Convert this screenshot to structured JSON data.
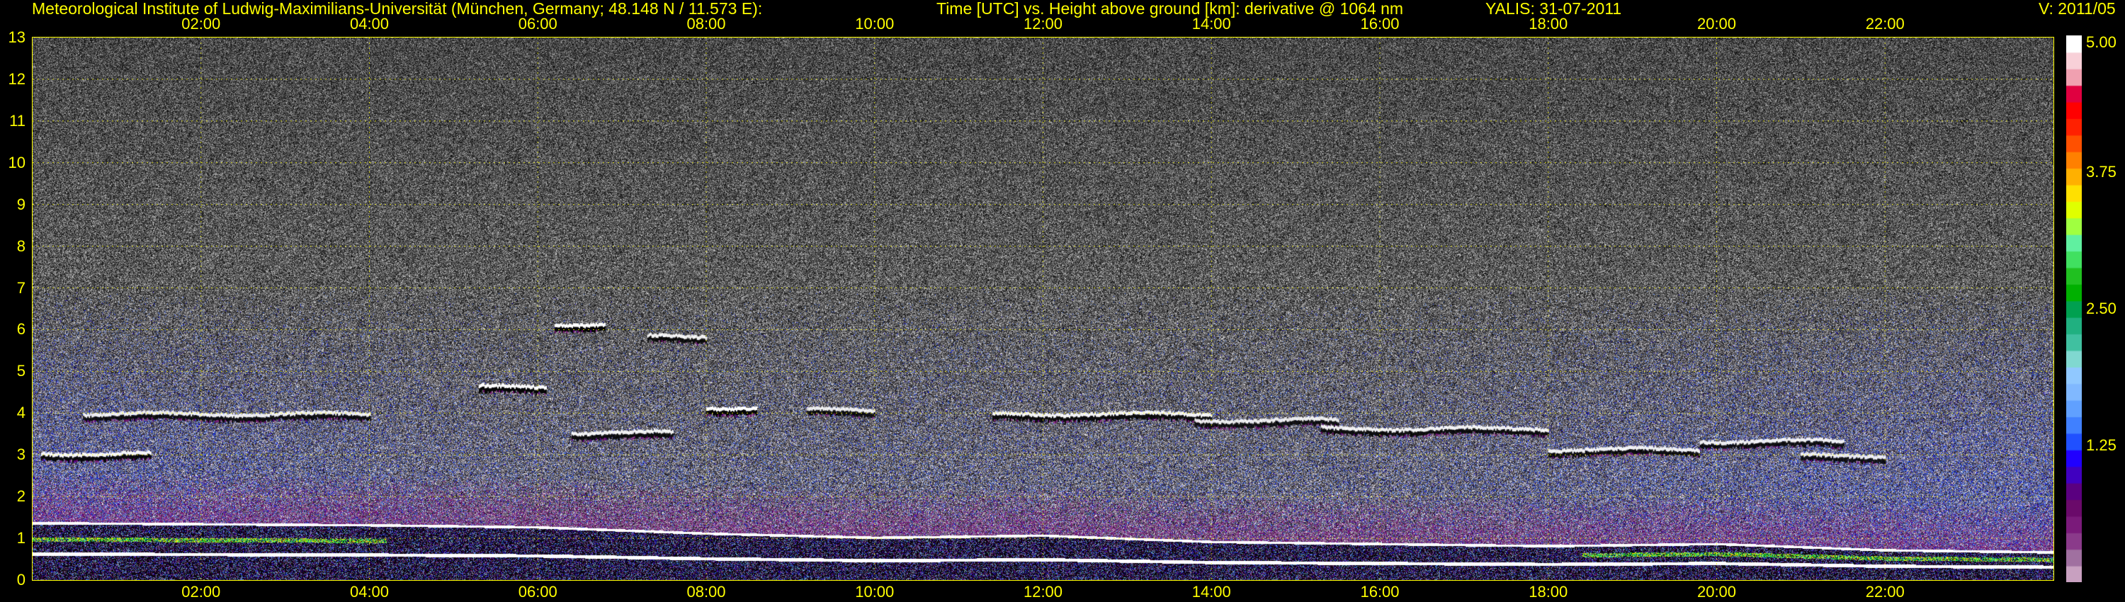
{
  "header": {
    "institute": "Meteorological Institute of Ludwig-Maximilians-Universität (München, Germany; 48.148 N / 11.573 E):",
    "axes": "Time [UTC] vs. Height above ground [km]: derivative @ 1064 nm",
    "instrument_date": "YALIS: 31-07-2011",
    "version": "V: 2011/05"
  },
  "colors": {
    "axis": "#ffff00",
    "background": "#000000",
    "noise": "#4e4e4e"
  },
  "chart_data": {
    "type": "heatmap",
    "title": "Time [UTC] vs. Height above ground [km]: derivative @ 1064 nm",
    "xlabel": "Time [UTC]",
    "ylabel": "Height above ground [km]",
    "xlim": [
      "00:00",
      "24:00"
    ],
    "ylim": [
      0,
      13
    ],
    "x_ticks": [
      "02:00",
      "04:00",
      "06:00",
      "08:00",
      "10:00",
      "12:00",
      "14:00",
      "16:00",
      "18:00",
      "20:00",
      "22:00"
    ],
    "x_tick_hours": [
      2,
      4,
      6,
      8,
      10,
      12,
      14,
      16,
      18,
      20,
      22
    ],
    "y_ticks": [
      0,
      1,
      2,
      3,
      4,
      5,
      6,
      7,
      8,
      9,
      10,
      11,
      12,
      13
    ],
    "grid": true,
    "colorbar": {
      "range": [
        0,
        5
      ],
      "labels": [
        "5.00",
        "3.75",
        "2.50",
        "1.25"
      ],
      "label_values": [
        5,
        3.75,
        2.5,
        1.25
      ],
      "colors": [
        "#c8a0c0",
        "#a070a0",
        "#8a3a8a",
        "#7a1a7a",
        "#6a0a6a",
        "#5a0080",
        "#4000c0",
        "#2000ff",
        "#2050ff",
        "#4080ff",
        "#60a0ff",
        "#80b8ff",
        "#90c8ff",
        "#80d8d0",
        "#40c0a0",
        "#20b080",
        "#00a050",
        "#00b000",
        "#20c020",
        "#40e060",
        "#60f0a0",
        "#a0ff40",
        "#e0ff00",
        "#ffe000",
        "#ffb000",
        "#ff8000",
        "#ff5000",
        "#ff2000",
        "#ff0000",
        "#e00040",
        "#f0a0b0",
        "#f8d0d8",
        "#ffffff"
      ]
    },
    "cloud_layers": [
      {
        "start_h": 0.1,
        "end_h": 1.4,
        "height_km": 3.0
      },
      {
        "start_h": 0.6,
        "end_h": 4.0,
        "height_km": 3.95
      },
      {
        "start_h": 5.3,
        "end_h": 6.1,
        "height_km": 4.6
      },
      {
        "start_h": 6.4,
        "end_h": 7.6,
        "height_km": 3.5
      },
      {
        "start_h": 6.2,
        "end_h": 6.8,
        "height_km": 6.1
      },
      {
        "start_h": 7.3,
        "end_h": 8.0,
        "height_km": 5.8
      },
      {
        "start_h": 8.0,
        "end_h": 8.6,
        "height_km": 4.1
      },
      {
        "start_h": 9.2,
        "end_h": 10.0,
        "height_km": 4.05
      },
      {
        "start_h": 11.4,
        "end_h": 14.0,
        "height_km": 3.95
      },
      {
        "start_h": 13.8,
        "end_h": 15.5,
        "height_km": 3.8
      },
      {
        "start_h": 15.3,
        "end_h": 18.0,
        "height_km": 3.6
      },
      {
        "start_h": 18.0,
        "end_h": 19.8,
        "height_km": 3.1
      },
      {
        "start_h": 19.8,
        "end_h": 21.5,
        "height_km": 3.3
      },
      {
        "start_h": 21.0,
        "end_h": 22.0,
        "height_km": 2.95
      }
    ],
    "boundary_layer": [
      {
        "hour": 0,
        "top_km": 1.4
      },
      {
        "hour": 4,
        "top_km": 1.35
      },
      {
        "hour": 6,
        "top_km": 1.3
      },
      {
        "hour": 8,
        "top_km": 1.15
      },
      {
        "hour": 10,
        "top_km": 1.05
      },
      {
        "hour": 12,
        "top_km": 1.1
      },
      {
        "hour": 14,
        "top_km": 0.95
      },
      {
        "hour": 16,
        "top_km": 0.9
      },
      {
        "hour": 18,
        "top_km": 0.85
      },
      {
        "hour": 20,
        "top_km": 0.9
      },
      {
        "hour": 22,
        "top_km": 0.75
      },
      {
        "hour": 24,
        "top_km": 0.7
      }
    ]
  }
}
